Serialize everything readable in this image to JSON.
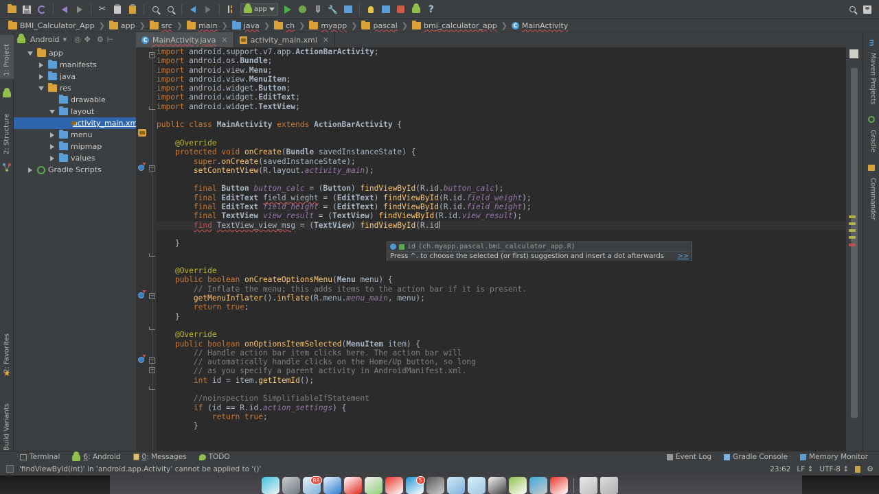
{
  "toolbar": {
    "icons": [
      {
        "name": "open-folder-icon",
        "glyph": "folder"
      },
      {
        "name": "save-all-icon",
        "glyph": "disk"
      },
      {
        "name": "sync-icon",
        "glyph": "sync"
      },
      {
        "name": "undo-icon",
        "glyph": "undo"
      },
      {
        "name": "redo-icon",
        "glyph": "redo"
      },
      {
        "name": "cut-icon",
        "glyph": "scissors"
      },
      {
        "name": "copy-icon",
        "glyph": "copy"
      },
      {
        "name": "paste-icon",
        "glyph": "paste"
      },
      {
        "name": "find-icon",
        "glyph": "magnifier"
      },
      {
        "name": "replace-icon",
        "glyph": "magnifier-replace"
      },
      {
        "name": "back-icon",
        "glyph": "arrow-left"
      },
      {
        "name": "forward-icon",
        "glyph": "arrow-right"
      },
      {
        "name": "sync-scroll-icon",
        "glyph": "bars"
      }
    ],
    "run_config": "app",
    "run_icons": [
      {
        "name": "run-button",
        "glyph": "play"
      },
      {
        "name": "debug-button",
        "glyph": "bug"
      },
      {
        "name": "run-coverage-button",
        "glyph": "coverage"
      },
      {
        "name": "sdk-manager-button",
        "glyph": "wrench"
      },
      {
        "name": "avd-manager-button",
        "glyph": "device"
      },
      {
        "name": "hint-button",
        "glyph": "bulb"
      },
      {
        "name": "layout-inspector-button",
        "glyph": "square-blue"
      },
      {
        "name": "android-monitor-button",
        "glyph": "monitor"
      },
      {
        "name": "android-button",
        "glyph": "android"
      },
      {
        "name": "help-button",
        "glyph": "question"
      }
    ],
    "right_icons": [
      {
        "name": "search-everywhere-icon",
        "glyph": "magnifier"
      },
      {
        "name": "account-icon",
        "glyph": "user"
      }
    ]
  },
  "breadcrumb": [
    {
      "label": "BMI_Calculator_App",
      "icon": "module-folder-icon",
      "error": false
    },
    {
      "label": "app",
      "icon": "module-folder-icon",
      "error": false
    },
    {
      "label": "src",
      "icon": "folder-icon",
      "error": true
    },
    {
      "label": "main",
      "icon": "folder-icon",
      "error": true
    },
    {
      "label": "java",
      "icon": "source-folder-icon",
      "error": true
    },
    {
      "label": "ch",
      "icon": "package-icon",
      "error": true
    },
    {
      "label": "myapp",
      "icon": "package-icon",
      "error": true
    },
    {
      "label": "pascal",
      "icon": "package-icon",
      "error": true
    },
    {
      "label": "bmi_calculator_app",
      "icon": "package-icon",
      "error": true
    },
    {
      "label": "MainActivity",
      "icon": "class-icon",
      "error": true
    }
  ],
  "left_strip": {
    "top": [
      {
        "label": "1: Project",
        "name": "tool-window-project",
        "selected": true
      },
      {
        "label": "2: Structure",
        "name": "tool-window-structure",
        "selected": false
      }
    ],
    "bottom": [
      {
        "label": "2: Favorites",
        "name": "tool-window-favorites"
      },
      {
        "label": "Build Variants",
        "name": "tool-window-build-variants"
      }
    ]
  },
  "right_strip": [
    {
      "label": "Maven Projects",
      "name": "tool-window-maven-projects"
    },
    {
      "label": "Gradle",
      "name": "tool-window-gradle"
    },
    {
      "label": "Commander",
      "name": "tool-window-commander"
    }
  ],
  "project_panel": {
    "title": "Android",
    "header_icons": [
      "chevron-down-icon",
      "target-icon",
      "expand-icon",
      "settings-icon",
      "collapse-icon"
    ],
    "tree": [
      {
        "label": "app",
        "depth": 0,
        "twisty": "down",
        "icon": "module-folder-icon",
        "selected": false
      },
      {
        "label": "manifests",
        "depth": 1,
        "twisty": "right",
        "icon": "folder-blue-icon",
        "selected": false
      },
      {
        "label": "java",
        "depth": 1,
        "twisty": "right",
        "icon": "folder-blue-icon",
        "selected": false
      },
      {
        "label": "res",
        "depth": 1,
        "twisty": "down",
        "icon": "module-folder-icon",
        "selected": false
      },
      {
        "label": "drawable",
        "depth": 2,
        "twisty": "none",
        "icon": "folder-blue-icon",
        "selected": false
      },
      {
        "label": "layout",
        "depth": 2,
        "twisty": "down",
        "icon": "folder-blue-icon",
        "selected": false
      },
      {
        "label": "activity_main.xml",
        "depth": 3,
        "twisty": "none",
        "icon": "xml-file-icon",
        "selected": true
      },
      {
        "label": "menu",
        "depth": 2,
        "twisty": "right",
        "icon": "folder-blue-icon",
        "selected": false
      },
      {
        "label": "mipmap",
        "depth": 2,
        "twisty": "right",
        "icon": "folder-blue-icon",
        "selected": false
      },
      {
        "label": "values",
        "depth": 2,
        "twisty": "right",
        "icon": "folder-blue-icon",
        "selected": false
      },
      {
        "label": "Gradle Scripts",
        "depth": 0,
        "twisty": "right",
        "icon": "gradle-icon",
        "selected": false
      }
    ]
  },
  "editor_tabs": [
    {
      "label": "MainActivity.java",
      "icon": "class-icon",
      "active": true,
      "error": true
    },
    {
      "label": "activity_main.xml",
      "icon": "xml-file-icon",
      "active": false,
      "error": false
    }
  ],
  "code_lines": [
    {
      "t": "imp",
      "text": "import android.support.v7.app.ActionBarActivity;"
    },
    {
      "t": "imp",
      "text": "import android.os.Bundle;"
    },
    {
      "t": "imp",
      "text": "import android.view.Menu;"
    },
    {
      "t": "imp",
      "text": "import android.view.MenuItem;"
    },
    {
      "t": "imp",
      "text": "import android.widget.Button;"
    },
    {
      "t": "imp",
      "text": "import android.widget.EditText;"
    },
    {
      "t": "imp",
      "text": "import android.widget.TextView;"
    },
    {
      "t": "blank",
      "text": ""
    },
    {
      "t": "cls",
      "text": "public class MainActivity extends ActionBarActivity {"
    },
    {
      "t": "blank",
      "text": ""
    },
    {
      "t": "ann",
      "text": "    @Override"
    },
    {
      "t": "sig",
      "text": "    protected void onCreate(Bundle savedInstanceState) {"
    },
    {
      "t": "c1",
      "text": "        super.onCreate(savedInstanceState);"
    },
    {
      "t": "c2",
      "text": "        setContentView(R.layout.activity_main);"
    },
    {
      "t": "blank",
      "text": ""
    },
    {
      "t": "f1",
      "text": "        final Button button_calc = (Button) findViewById(R.id.button_calc);"
    },
    {
      "t": "f2",
      "text": "        final EditText field_wieght = (EditText) findViewById(R.id.field_weight);"
    },
    {
      "t": "f3",
      "text": "        final EditText field_height = (EditText) findViewById(R.id.field_height);"
    },
    {
      "t": "f4",
      "text": "        final TextView view_result = (TextView) findViewById(R.id.view_result);"
    },
    {
      "t": "f5",
      "text": "        find TextView_view_msg = (TextView) findViewById(R.id"
    },
    {
      "t": "blank",
      "text": ""
    },
    {
      "t": "brace",
      "text": "    }"
    },
    {
      "t": "blank",
      "text": ""
    },
    {
      "t": "blank",
      "text": ""
    },
    {
      "t": "ann",
      "text": "    @Override"
    },
    {
      "t": "sig2",
      "text": "    public boolean onCreateOptionsMenu(Menu menu) {"
    },
    {
      "t": "cmt",
      "text": "        // Inflate the menu; this adds items to the action bar if it is present."
    },
    {
      "t": "c3",
      "text": "        getMenuInflater().inflate(R.menu.menu_main, menu);"
    },
    {
      "t": "ret",
      "text": "        return true;"
    },
    {
      "t": "brace",
      "text": "    }"
    },
    {
      "t": "blank",
      "text": ""
    },
    {
      "t": "ann",
      "text": "    @Override"
    },
    {
      "t": "sig3",
      "text": "    public boolean onOptionsItemSelected(MenuItem item) {"
    },
    {
      "t": "cmt",
      "text": "        // Handle action bar item clicks here. The action bar will"
    },
    {
      "t": "cmt",
      "text": "        // automatically handle clicks on the Home/Up button, so long"
    },
    {
      "t": "cmt",
      "text": "        // as you specify a parent activity in AndroidManifest.xml."
    },
    {
      "t": "c4",
      "text": "        int id = item.getItemId();"
    },
    {
      "t": "blank",
      "text": ""
    },
    {
      "t": "cmt",
      "text": "        //noinspection SimplifiableIfStatement"
    },
    {
      "t": "if1",
      "text": "        if (id == R.id.action_settings) {"
    },
    {
      "t": "ret2",
      "text": "            return true;"
    },
    {
      "t": "brace2",
      "text": "        }"
    }
  ],
  "completion_popup": {
    "item_label": "id",
    "item_qualifier": "(ch.myapp.pascal.bmi_calculator_app.R)",
    "hint": "Press ^. to choose the selected (or first) suggestion and insert a dot afterwards",
    "hint_chevron": ">>"
  },
  "bottom_tools": [
    {
      "label": "Terminal",
      "mnemonic": "",
      "icon": "terminal-icon"
    },
    {
      "label": ": Android",
      "mnemonic": "6",
      "icon": "android-icon"
    },
    {
      "label": ": Messages",
      "mnemonic": "0",
      "icon": "messages-icon"
    },
    {
      "label": "TODO",
      "mnemonic": "",
      "icon": "todo-icon"
    }
  ],
  "bottom_tools_right": [
    {
      "label": "Event Log",
      "icon": "event-log-icon"
    },
    {
      "label": "Gradle Console",
      "icon": "gradle-console-icon"
    },
    {
      "label": "Memory Monitor",
      "icon": "memory-monitor-icon"
    }
  ],
  "status_bar": {
    "message": "'findViewById(int)' in 'android.app.Activity' cannot be applied to '()'",
    "caret_position": "23:62",
    "line_separator": "LF",
    "encoding": "UTF-8",
    "lock_icon": "lock-icon",
    "inspection_icon": "inspections-icon"
  },
  "dock": [
    {
      "name": "finder-icon",
      "colors": [
        "#39c3e0",
        "#f2f2f2"
      ],
      "badge": null
    },
    {
      "name": "telegram-icon",
      "colors": [
        "#c9cdd0",
        "#6f7a80"
      ],
      "badge": null
    },
    {
      "name": "mail-icon",
      "colors": [
        "#e9eef2",
        "#7fb3dd"
      ],
      "badge": "88"
    },
    {
      "name": "safari-icon",
      "colors": [
        "#e8f2fa",
        "#2c7fd0"
      ],
      "badge": null
    },
    {
      "name": "calendar-icon",
      "colors": [
        "#ffffff",
        "#e02b20"
      ],
      "badge": null
    },
    {
      "name": "preview-icon",
      "colors": [
        "#f0f0f0",
        "#8fd07a"
      ],
      "badge": null
    },
    {
      "name": "messages-red-icon",
      "colors": [
        "#e8342a",
        "#ffffff"
      ],
      "badge": null
    },
    {
      "name": "drive-icon",
      "colors": [
        "#2196d8",
        "#ffffff"
      ],
      "badge": "5"
    },
    {
      "name": "system-preferences-icon",
      "colors": [
        "#5a5a5a",
        "#cccccc"
      ],
      "badge": null
    },
    {
      "name": "xcode-icon",
      "colors": [
        "#cfe8f5",
        "#7fb3dd"
      ],
      "badge": null
    },
    {
      "name": "vm-icon",
      "colors": [
        "#d8eef8",
        "#9fc8e0"
      ],
      "badge": null
    },
    {
      "name": "github-icon",
      "colors": [
        "#f2f2f2",
        "#444444"
      ],
      "badge": null
    },
    {
      "name": "android-studio-icon",
      "colors": [
        "#8fc04a",
        "#ffffff"
      ],
      "badge": null
    },
    {
      "name": "utilities-icon",
      "colors": [
        "#3fa9dd",
        "#c9c9c9"
      ],
      "badge": null
    },
    {
      "name": "blocked-icon",
      "colors": [
        "#e8342a",
        "#ffffff"
      ],
      "badge": null
    },
    {
      "name": "documents-stack-icon",
      "colors": [
        "#e8e8e8",
        "#bfbfbf"
      ],
      "badge": null
    },
    {
      "name": "trash-icon",
      "colors": [
        "#dcdcdc",
        "#b0b0b0"
      ],
      "badge": null
    }
  ],
  "colors": {
    "chrome": "#3c3f41",
    "editor_bg": "#2b2b2b",
    "selection": "#2f65ad",
    "accent_orange": "#cc7832",
    "accent_green": "#6a8759",
    "error_red": "#c05050"
  }
}
